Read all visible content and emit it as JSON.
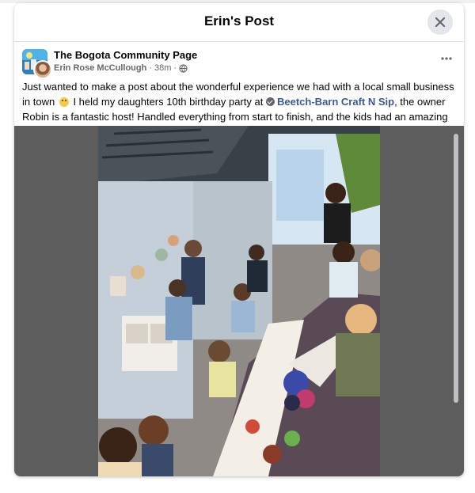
{
  "modal": {
    "title": "Erin's Post"
  },
  "post": {
    "group_name": "The Bogota Community Page",
    "author": "Erin Rose McCullough",
    "time": "38m",
    "separator": "·",
    "audience_icon": "globe-icon",
    "text_before_link": "Just wanted to make a post about the wonderful experience we had with a local small business in town",
    "text_mid": "I held my daughters 10th birthday party at",
    "business_name": "Beetch-Barn Craft N Sip",
    "text_after_link": ", the owner Robin is a fantastic host! Handled everything from start to finish, and the kids had an amazing time!!",
    "emoji": "smiling-face-emoji"
  },
  "icons": {
    "close": "close-icon",
    "more": "more-options-icon"
  },
  "colors": {
    "link": "#385898",
    "photo_backdrop": "#5d5d5d",
    "close_button_bg": "#e4e6eb"
  }
}
